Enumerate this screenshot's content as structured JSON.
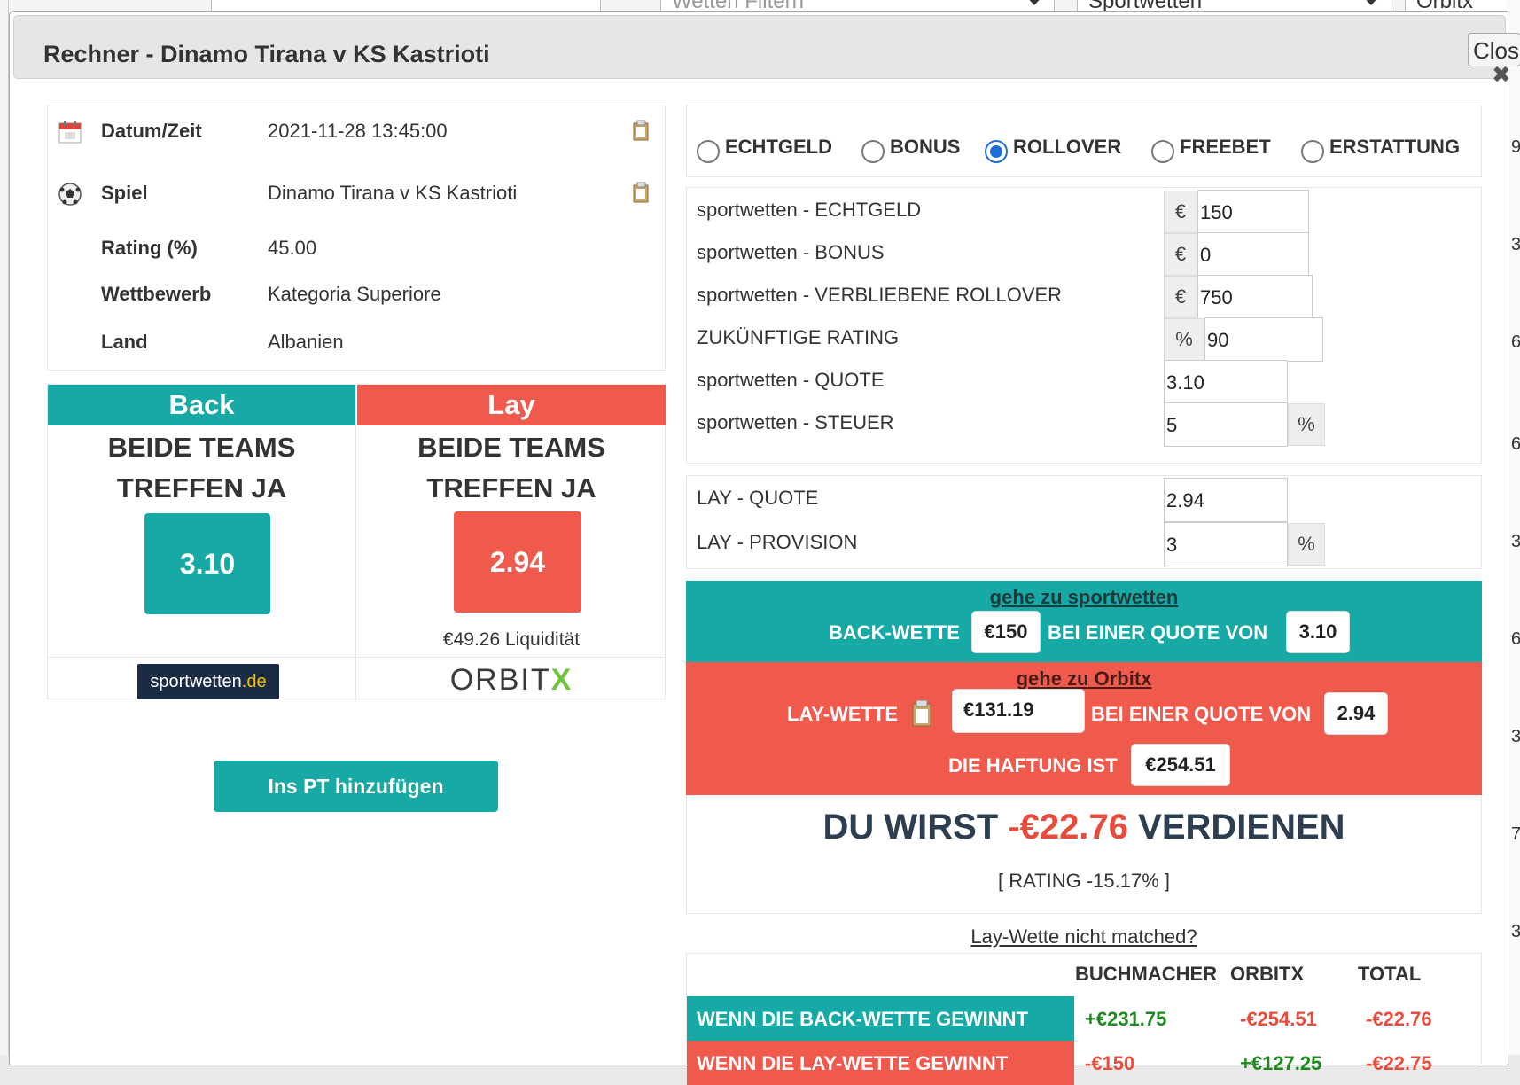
{
  "background": {
    "filter_placeholder": "Wetten Filtern",
    "sport_select": "Sportwetten",
    "exchange_select": "Orbitx",
    "right_numbers": [
      "9",
      "3",
      "6",
      "6",
      "3",
      "6",
      "3",
      "7",
      "3"
    ]
  },
  "dialog": {
    "title": "Rechner - Dinamo Tirana v KS Kastrioti",
    "close_label": "Close",
    "close_x": "✖"
  },
  "info": {
    "rows": [
      {
        "label": "Datum/Zeit",
        "value": "2021-11-28 13:45:00",
        "icon": "calendar-icon",
        "copy": true
      },
      {
        "label": "Spiel",
        "value": "Dinamo Tirana v KS Kastrioti",
        "icon": "soccer-ball-icon",
        "copy": true
      },
      {
        "label": "Rating (%)",
        "value": "45.00"
      },
      {
        "label": "Wettbewerb",
        "value": "Kategoria Superiore"
      },
      {
        "label": "Land",
        "value": "Albanien"
      }
    ]
  },
  "back": {
    "header": "Back",
    "market_line1": "BEIDE TEAMS",
    "market_line2": "TREFFEN JA",
    "odds": "3.10",
    "bookmaker_logo": {
      "main": "sportwetten",
      "suffix": ".de"
    }
  },
  "lay": {
    "header": "Lay",
    "market_line1": "BEIDE TEAMS",
    "market_line2": "TREFFEN JA",
    "odds": "2.94",
    "liquidity": "€49.26 Liquidität",
    "exchange_logo": {
      "main": "ORBIT",
      "suffix": "X"
    }
  },
  "add_button": "Ins PT hinzufügen",
  "bet_types": [
    {
      "label": "ECHTGELD",
      "selected": false
    },
    {
      "label": "BONUS",
      "selected": false
    },
    {
      "label": "ROLLOVER",
      "selected": true
    },
    {
      "label": "FREEBET",
      "selected": false
    },
    {
      "label": "ERSTATTUNG",
      "selected": false
    }
  ],
  "fields": {
    "echtgeld": {
      "label": "sportwetten - ECHTGELD",
      "unit": "€",
      "value": "150"
    },
    "bonus": {
      "label": "sportwetten - BONUS",
      "unit": "€",
      "value": "0"
    },
    "rollover": {
      "label": "sportwetten - VERBLIEBENE ROLLOVER",
      "unit": "€",
      "value": "750"
    },
    "future_rating": {
      "label": "ZUKÜNFTIGE RATING",
      "unit": "%",
      "value": "90"
    },
    "quote": {
      "label": "sportwetten - QUOTE",
      "value": "3.10"
    },
    "tax": {
      "label": "sportwetten - STEUER",
      "value": "5",
      "unit": "%"
    },
    "lay_quote": {
      "label": "LAY - QUOTE",
      "value": "2.94"
    },
    "lay_commission": {
      "label": "LAY - PROVISION",
      "value": "3",
      "unit": "%"
    }
  },
  "back_instruction": {
    "link": "gehe zu sportwetten",
    "prefix": "BACK-WETTE",
    "stake": "€150",
    "middle": "BEI EINER QUOTE VON",
    "odds": "3.10"
  },
  "lay_instruction": {
    "link": "gehe zu Orbitx",
    "prefix": "LAY-WETTE",
    "stake": "€131.19",
    "middle": "BEI EINER QUOTE VON",
    "odds": "2.94",
    "liability_label": "DIE HAFTUNG IST",
    "liability": "€254.51"
  },
  "result": {
    "prefix": "DU WIRST",
    "amount": "-€22.76",
    "suffix": "VERDIENEN",
    "rating": "[ RATING -15.17% ]"
  },
  "not_matched_link": "Lay-Wette nicht matched?",
  "outcome_table": {
    "headers": [
      "BUCHMACHER",
      "ORBITX",
      "TOTAL"
    ],
    "rows": [
      {
        "label": "WENN DIE BACK-WETTE GEWINNT",
        "bookmaker": "+€231.75",
        "exchange": "-€254.51",
        "total": "-€22.76"
      },
      {
        "label": "WENN DIE LAY-WETTE GEWINNT",
        "bookmaker": "-€150",
        "exchange": "+€127.25",
        "total": "-€22.75"
      }
    ]
  },
  "colors": {
    "teal": "#17a9a6",
    "red": "#ef5a4d",
    "negative": "#e74c3c",
    "positive": "#1e8a1e"
  }
}
